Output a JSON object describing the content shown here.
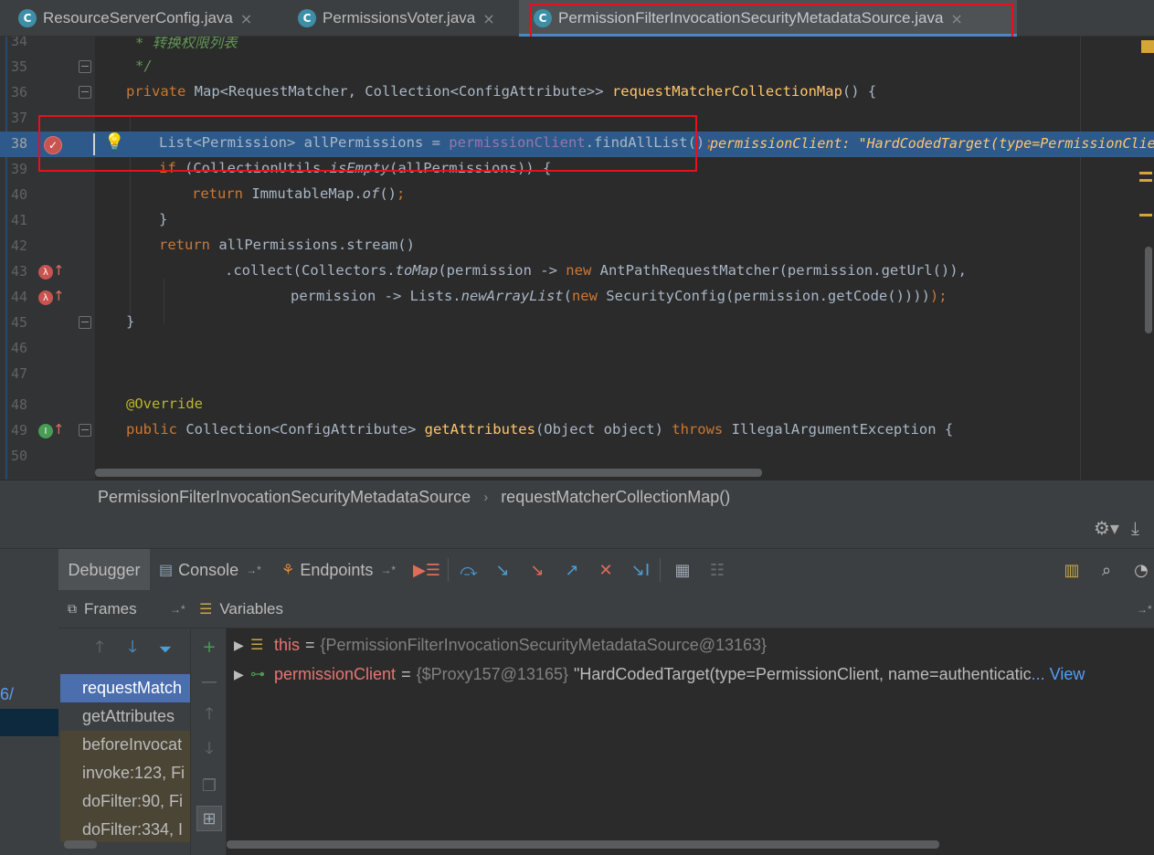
{
  "tabs": [
    {
      "label": "ResourceServerConfig.java",
      "icon": "C",
      "close": "×"
    },
    {
      "label": "PermissionsVoter.java",
      "icon": "C",
      "close": "×"
    },
    {
      "label": "PermissionFilterInvocationSecurityMetadataSource.java",
      "icon": "C",
      "close": "×"
    }
  ],
  "editor": {
    "line_numbers": [
      "34",
      "35",
      "36",
      "37",
      "38",
      "39",
      "40",
      "41",
      "42",
      "43",
      "44",
      "45",
      "46",
      "47",
      "48",
      "49",
      "50"
    ],
    "comment_34": "* 转换权限列表",
    "comment_35": "*/",
    "l36": {
      "kw": "private",
      "type1": "Map<RequestMatcher, Collection<ConfigAttribute>>",
      "fn": "requestMatcherCollectionMap",
      "rest": "() {"
    },
    "l38": {
      "type": "List<Permission>",
      "var": " allPermissions = ",
      "field": "permissionClient",
      "call": ".findAllList()",
      "semi": ";"
    },
    "l38_hint": "permissionClient: \"HardCodedTarget(type=PermissionClie",
    "l39": {
      "kw": "if",
      "a": " (CollectionUtils.",
      "it": "isEmpty",
      "b": "(allPermissions)) {"
    },
    "l40": {
      "kw": "return",
      "a": " ImmutableMap.",
      "it": "of",
      "b": "()",
      "semi": ";"
    },
    "l41": "}",
    "l42": {
      "kw": "return",
      "a": " allPermissions.stream()"
    },
    "l43": {
      "a": ".collect(Collectors.",
      "it": "toMap",
      "b": "(permission -> ",
      "kw": "new",
      "c": " AntPathRequestMatcher(permission.getUrl()),"
    },
    "l44": {
      "a": "permission -> Lists.",
      "it": "newArrayList",
      "b": "(",
      "kw": "new",
      "c": " SecurityConfig(permission.getCode())))",
      "semi": ");"
    },
    "l45": "}",
    "l48": "@Override",
    "l49": {
      "kw": "public",
      "a": " Collection<ConfigAttribute> ",
      "fn": "getAttributes",
      "b": "(Object object) ",
      "kw2": "throws",
      "c": " IllegalArgumentException {"
    }
  },
  "breadcrumb": {
    "class_name": "PermissionFilterInvocationSecurityMetadataSource",
    "separator": "›",
    "method": "requestMatcherCollectionMap()"
  },
  "debug": {
    "tabs": [
      {
        "label": "Debugger"
      },
      {
        "label": "Console",
        "pin": "→*"
      },
      {
        "label": "Endpoints",
        "pin": "→*"
      }
    ],
    "left_strip_text": "6/",
    "frames": {
      "title": "Frames",
      "pin": "→*",
      "items": [
        "requestMatch",
        "getAttributes",
        "beforeInvocat",
        "invoke:123, Fi",
        "doFilter:90, Fi",
        "doFilter:334, I"
      ]
    },
    "variables": {
      "title": "Variables",
      "pin": "→*",
      "rows": [
        {
          "name": "this",
          "eq": "=",
          "type": "{PermissionFilterInvocationSecurityMetadataSource@13163}",
          "value": "",
          "link": ""
        },
        {
          "name": "permissionClient",
          "eq": "=",
          "type": "{$Proxy157@13165}",
          "value": "\"HardCodedTarget(type=PermissionClient, name=authenticatic",
          "link": "... View"
        }
      ]
    }
  },
  "colors": {
    "accent_blue": "#4a88c7",
    "highlight_line": "#2d5a8b",
    "red_annotation": "#e8111b",
    "keyword": "#cc7832",
    "function": "#ffc66d",
    "selected_frame": "#4b6eaf"
  }
}
